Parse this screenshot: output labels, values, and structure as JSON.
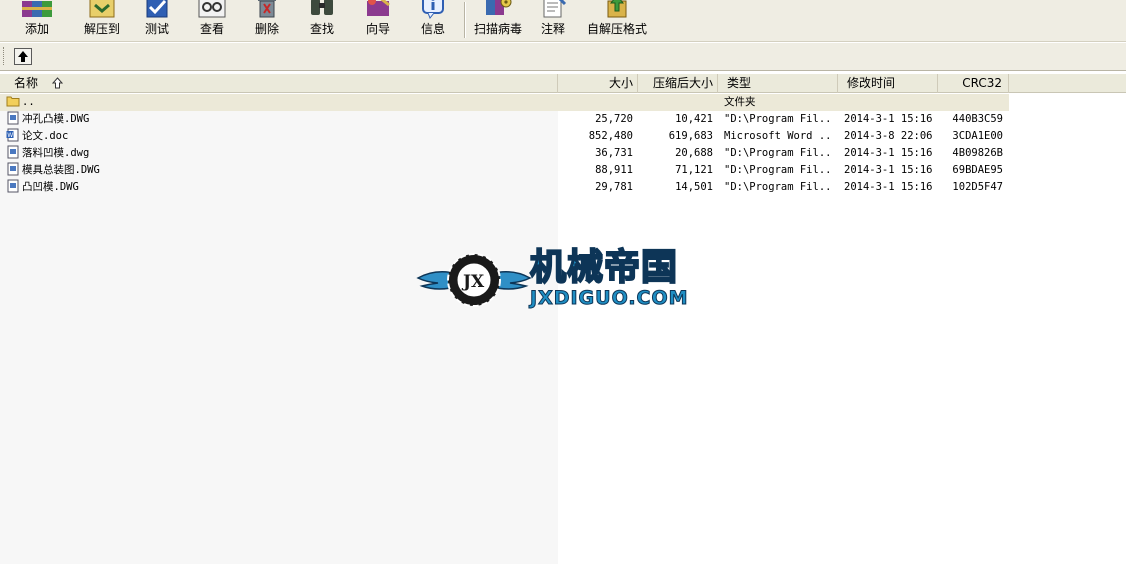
{
  "toolbar": {
    "buttons": [
      {
        "label": "添加",
        "icon": "add-archive-icon"
      },
      {
        "label": "解压到",
        "icon": "extract-to-icon"
      },
      {
        "label": "测试",
        "icon": "test-icon"
      },
      {
        "label": "查看",
        "icon": "view-icon"
      },
      {
        "label": "删除",
        "icon": "delete-icon"
      },
      {
        "label": "查找",
        "icon": "find-icon"
      },
      {
        "label": "向导",
        "icon": "wizard-icon"
      },
      {
        "label": "信息",
        "icon": "info-icon"
      },
      {
        "label": "扫描病毒",
        "icon": "scan-virus-icon"
      },
      {
        "label": "注释",
        "icon": "comment-icon"
      },
      {
        "label": "自解压格式",
        "icon": "sfx-icon"
      }
    ]
  },
  "columns": {
    "name": "名称",
    "size": "大小",
    "packed": "压缩后大小",
    "type": "类型",
    "modified": "修改时间",
    "crc": "CRC32"
  },
  "files": [
    {
      "name": "..",
      "size": "",
      "packed": "",
      "type": "文件夹",
      "modified": "",
      "crc": "",
      "icon": "folder-icon"
    },
    {
      "name": "冲孔凸模.DWG",
      "size": "25,720",
      "packed": "10,421",
      "type": "\"D:\\Program Fil...",
      "modified": "2014-3-1 15:16",
      "crc": "440B3C59",
      "icon": "dwg-file-icon"
    },
    {
      "name": "论文.doc",
      "size": "852,480",
      "packed": "619,683",
      "type": "Microsoft Word ...",
      "modified": "2014-3-8 22:06",
      "crc": "3CDA1E00",
      "icon": "word-file-icon"
    },
    {
      "name": "落料凹模.dwg",
      "size": "36,731",
      "packed": "20,688",
      "type": "\"D:\\Program Fil...",
      "modified": "2014-3-1 15:16",
      "crc": "4B09826B",
      "icon": "dwg-file-icon"
    },
    {
      "name": "模具总装图.DWG",
      "size": "88,911",
      "packed": "71,121",
      "type": "\"D:\\Program Fil...",
      "modified": "2014-3-1 15:16",
      "crc": "69BDAE95",
      "icon": "dwg-file-icon"
    },
    {
      "name": "凸凹模.DWG",
      "size": "29,781",
      "packed": "14,501",
      "type": "\"D:\\Program Fil...",
      "modified": "2014-3-1 15:16",
      "crc": "102D5F47",
      "icon": "dwg-file-icon"
    }
  ],
  "watermark": {
    "title": "机械帝国",
    "subtitle": "JXDIGUO.COM",
    "badge": "JX"
  }
}
